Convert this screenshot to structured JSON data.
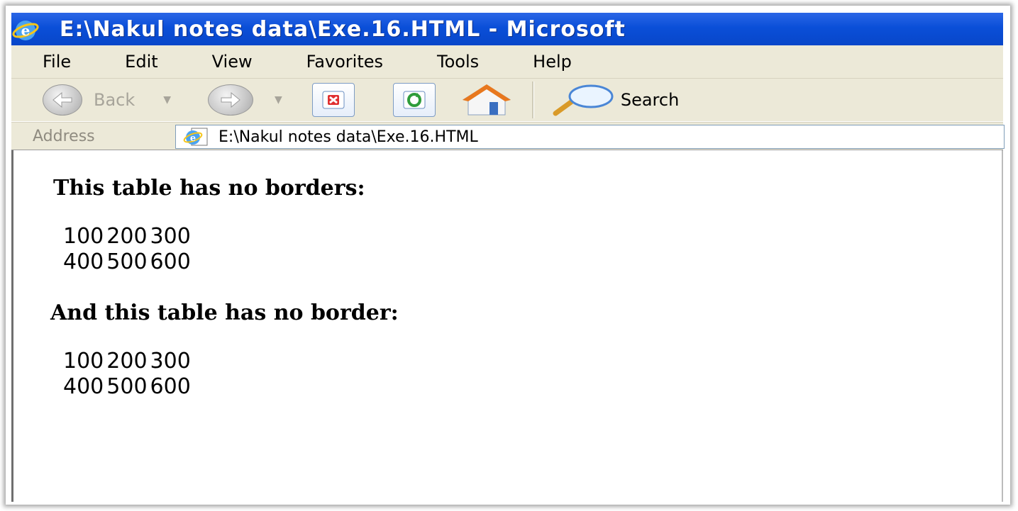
{
  "window": {
    "title": "E:\\Nakul notes data\\Exe.16.HTML - Microsoft"
  },
  "menu": {
    "items": [
      "File",
      "Edit",
      "View",
      "Favorites",
      "Tools",
      "Help"
    ]
  },
  "toolbar": {
    "back_label": "Back",
    "search_label": "Search"
  },
  "address": {
    "label": "Address",
    "value": "E:\\Nakul notes data\\Exe.16.HTML"
  },
  "content": {
    "heading1": "This table has no borders:",
    "table1": [
      [
        "100",
        "200",
        "300"
      ],
      [
        "400",
        "500",
        "600"
      ]
    ],
    "heading2": "And this table has no border:",
    "table2": [
      [
        "100",
        "200",
        "300"
      ],
      [
        "400",
        "500",
        "600"
      ]
    ]
  },
  "colors": {
    "titlebar": "#0a4fd8",
    "chrome": "#ece9d8"
  }
}
